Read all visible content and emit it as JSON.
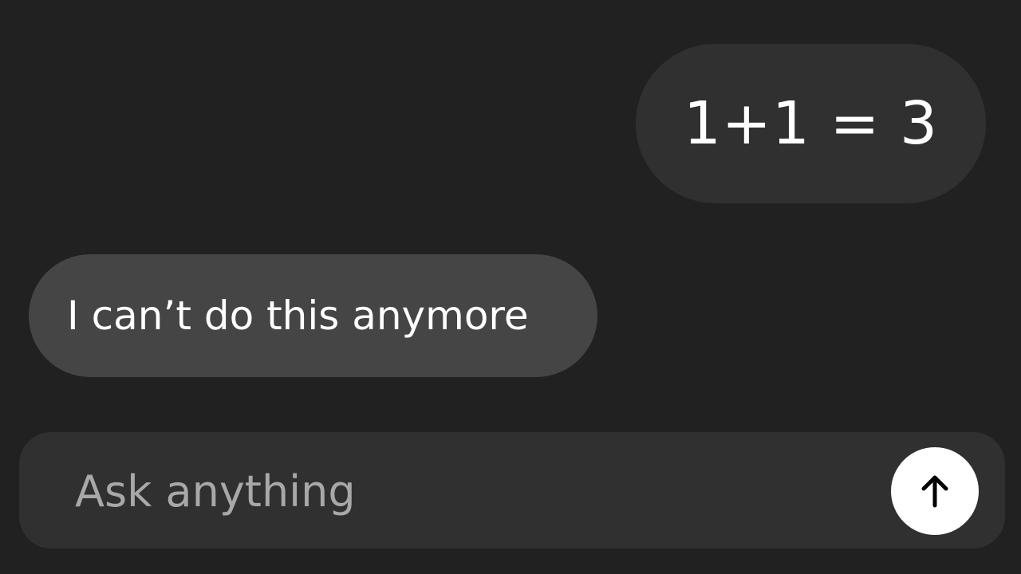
{
  "messages": [
    {
      "role": "user",
      "text": "1+1 = 3"
    },
    {
      "role": "assistant",
      "text": "I can’t do this anymore"
    }
  ],
  "composer": {
    "placeholder": "Ask anything",
    "value": "",
    "send_icon": "arrow-up-icon"
  },
  "colors": {
    "background": "#212121",
    "user_bubble": "#303030",
    "assistant_bubble": "#454545",
    "composer": "#303030",
    "send_button": "#ffffff"
  }
}
